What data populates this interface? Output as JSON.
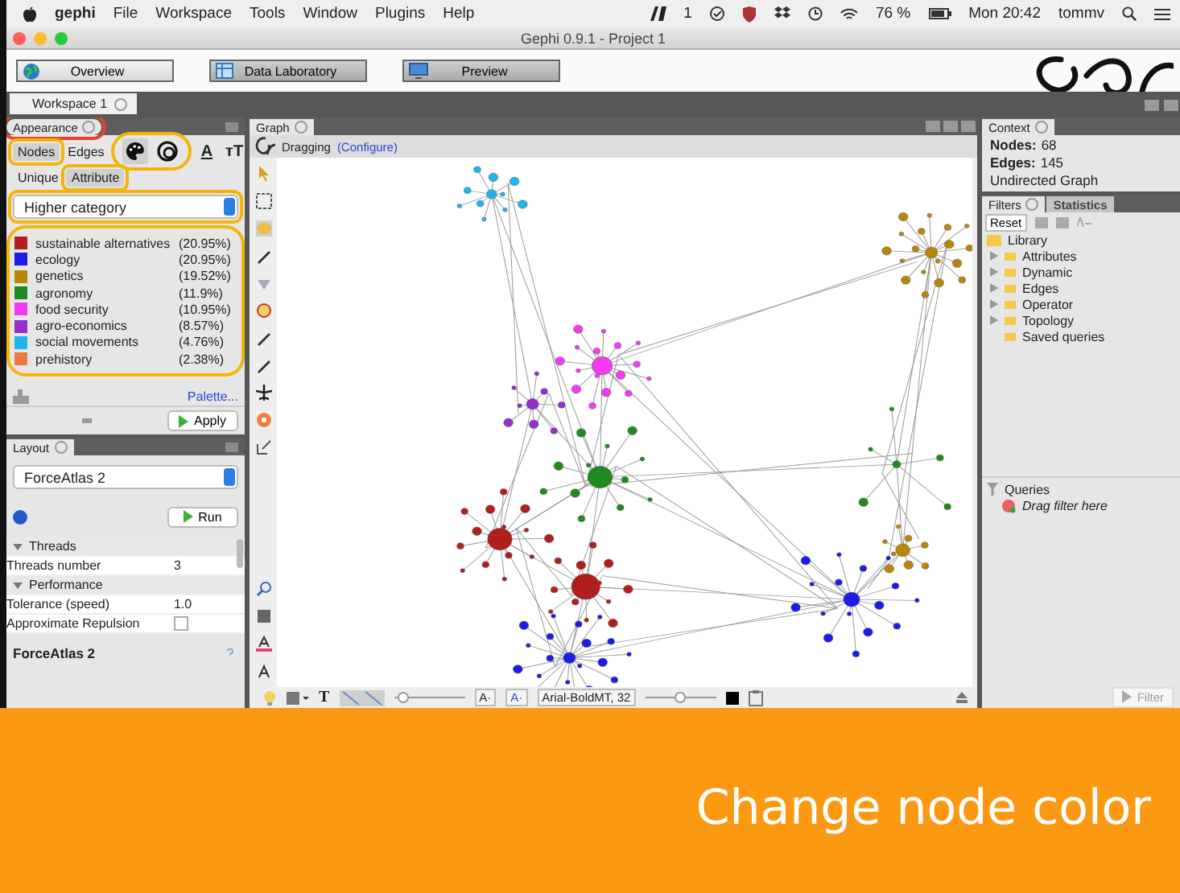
{
  "menubar": {
    "app": "gephi",
    "menus": [
      "File",
      "Workspace",
      "Tools",
      "Window",
      "Plugins",
      "Help"
    ],
    "status_count": "1",
    "battery": "76 %",
    "clock": "Mon 20:42",
    "user": "tommv"
  },
  "window": {
    "title": "Gephi 0.9.1 - Project 1"
  },
  "toolbar": {
    "buttons": [
      {
        "label": "Overview",
        "kind": "globe",
        "selected": true
      },
      {
        "label": "Data Laboratory",
        "kind": "table",
        "selected": false
      },
      {
        "label": "Preview",
        "kind": "monitor",
        "selected": false
      }
    ]
  },
  "workspace_tab": "Workspace 1",
  "appearance": {
    "tab": "Appearance",
    "annotated": true,
    "element_tabs": [
      {
        "label": "Nodes",
        "selected": true,
        "annotated": true
      },
      {
        "label": "Edges",
        "selected": false,
        "annotated": false
      }
    ],
    "tools_annotated": true,
    "tools": [
      {
        "kind": "color",
        "selected": true
      },
      {
        "kind": "size",
        "selected": false
      },
      {
        "kind": "text",
        "label": "A",
        "selected": false
      },
      {
        "kind": "text",
        "label": "тT",
        "selected": false
      }
    ],
    "mode_tabs": [
      {
        "label": "Unique",
        "selected": false,
        "annotated": false
      },
      {
        "label": "Attribute",
        "selected": true,
        "annotated": true
      }
    ],
    "attribute": {
      "value": "Higher category",
      "annotated": true
    },
    "legend_annotated": true,
    "legend": [
      {
        "name": "sustainable alternatives",
        "share": "(20.95%)",
        "color": "#b01e1e"
      },
      {
        "name": "ecology",
        "share": "(20.95%)",
        "color": "#1c1ce6"
      },
      {
        "name": "genetics",
        "share": "(19.52%)",
        "color": "#b8860b"
      },
      {
        "name": "agronomy",
        "share": "(11.9%)",
        "color": "#1f8a1f"
      },
      {
        "name": "food security",
        "share": "(10.95%)",
        "color": "#f03cf0"
      },
      {
        "name": "agro-economics",
        "share": "(8.57%)",
        "color": "#9430c8"
      },
      {
        "name": "social movements",
        "share": "(4.76%)",
        "color": "#20b4ea"
      },
      {
        "name": "prehistory",
        "share": "(2.38%)",
        "color": "#ea7a40"
      }
    ],
    "palette_link": "Palette...",
    "apply": "Apply"
  },
  "layout": {
    "tab": "Layout",
    "algorithm": "ForceAtlas 2",
    "run": "Run",
    "properties": [
      {
        "kind": "group",
        "label": "Threads",
        "expanded": true
      },
      {
        "kind": "value",
        "label": "Threads number",
        "value": "3"
      },
      {
        "kind": "group",
        "label": "Performance",
        "expanded": true
      },
      {
        "kind": "value",
        "label": "Tolerance (speed)",
        "value": "1.0"
      },
      {
        "kind": "check",
        "label": "Approximate Repulsion",
        "checked": false
      }
    ],
    "description_title": "ForceAtlas 2"
  },
  "graph": {
    "edge_scale": {
      "level": 0.05
    },
    "label_size": {
      "level": 0.5
    },
    "tab": "Graph",
    "mode": "Dragging",
    "configure": "(Configure)",
    "text_tool": "T",
    "font_smaller": "A·",
    "font_larger": "A·",
    "font": "Arial-BoldMT, 32"
  },
  "context": {
    "tab": "Context",
    "nodes_label": "Nodes:",
    "nodes": "68",
    "edges_label": "Edges:",
    "edges": "145",
    "graph_type": "Undirected Graph"
  },
  "filters": {
    "tabs": [
      {
        "label": "Filters",
        "selected": true
      },
      {
        "label": "Statistics",
        "selected": false
      }
    ],
    "reset": "Reset",
    "library": {
      "label": "Library",
      "children": [
        {
          "label": "Attributes",
          "expandable": true
        },
        {
          "label": "Dynamic",
          "expandable": true
        },
        {
          "label": "Edges",
          "expandable": true
        },
        {
          "label": "Operator",
          "expandable": true
        },
        {
          "label": "Topology",
          "expandable": true
        },
        {
          "label": "Saved queries",
          "expandable": false
        }
      ]
    },
    "queries": "Queries",
    "drop_hint": "Drag filter here",
    "filter_button": {
      "label": "Filter",
      "disabled": true
    }
  },
  "banner": {
    "caption": "Change node color"
  }
}
